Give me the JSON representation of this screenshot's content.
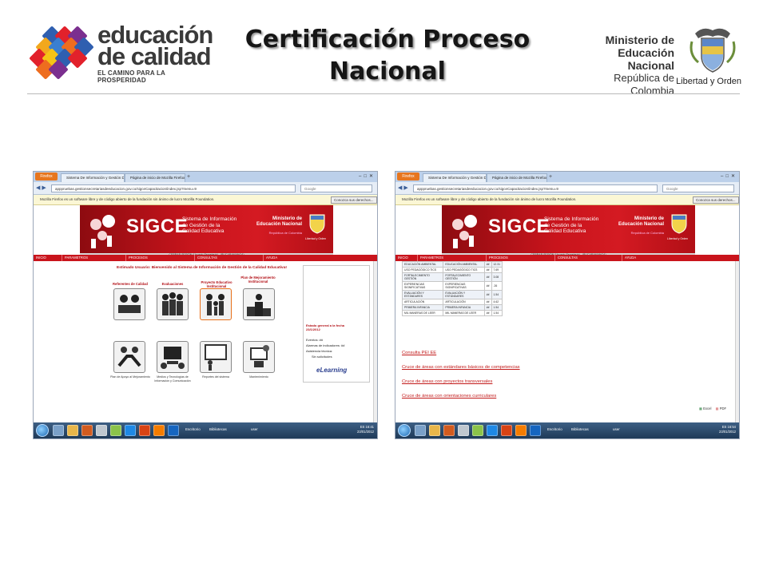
{
  "slide": {
    "title_line1": "Certificación Proceso",
    "title_line2": "Nacional",
    "left_logo": {
      "line1": "educación",
      "line2": "de calidad",
      "tagline": "EL CAMINO PARA LA PROSPERIDAD"
    },
    "right_logo": {
      "line1": "Ministerio de",
      "line2": "Educación Nacional",
      "line3": "República de Colombia",
      "motto": "Libertad y Orden"
    }
  },
  "browser_common": {
    "firefox_button": "Firefox",
    "tab1": "Sistema De Información y Gestión D...",
    "tab2": "Página de inicio de Mozilla Firefox",
    "url": "apppruebas.gestionsecretariasdeeducacion.gov.co/sigceCapacitacion/index.jsp?menu=9",
    "search_placeholder": "Google",
    "infobar_text": "Mozilla Firefox es un software libre y de código abierto de la fundación sin ánimo de lucro Mozilla Foundation.",
    "infobar_button": "Conozca sus derechos...",
    "banner_sigce": "SIGCE",
    "banner_sub1": "Sistema de Información",
    "banner_sub2": "de Gestión de la",
    "banner_sub3": "Calidad Educativa",
    "banner_min1": "Ministerio de",
    "banner_min2": "Educación Nacional",
    "banner_rep": "República de Colombia",
    "banner_motto": "Libertad y Orden",
    "session_text": "CERRAR SESIÓN (Usuario Secretaría) - (BUCARAMANGA)",
    "menu": [
      "INICIO",
      "PARAMETROS",
      "PROCESOS",
      "CONSULTAS",
      "AYUDA"
    ],
    "taskbar_escritorio": "Escritorio",
    "taskbar_bibliotecas": "Bibliotecas",
    "taskbar_user": "user",
    "tray_lang": "ES"
  },
  "left_browser": {
    "welcome": "Estimado Usuario: Bienvenido al Sistema de Información de Gestión de la Calidad Educativa!",
    "modules_top": [
      {
        "label": "Referentes de Calidad"
      },
      {
        "label": "Evaluaciones"
      },
      {
        "label": "Proyecto Educativo Institucional"
      },
      {
        "label": "Plan de Mejoramiento Institucional"
      }
    ],
    "modules_bottom": [
      {
        "label": "Plan de Apoyo al Mejoramiento"
      },
      {
        "label": "Medios y Tecnologías de Información y Comunicación"
      },
      {
        "label": "Reportes del sistema"
      },
      {
        "label": "Mantenimiento"
      }
    ],
    "panel_state_title": "Estado general a la fecha",
    "panel_state_date": "23/1/2012",
    "panel_eventos": "Eventos: ##",
    "panel_alarmas": "Alarmas de indicadores: ##",
    "panel_asistencia": "Asistencia técnica:",
    "panel_solicitudes": "Sin solicitudes",
    "elearning": "eLearning",
    "tray_time": "16:41",
    "tray_date": "23/01/2012"
  },
  "right_browser": {
    "table_rows": [
      [
        "EDUCACIÓN AMBIENTAL",
        "EDUCACIÓN AMBIENTAL",
        "##",
        "12.31"
      ],
      [
        "USO PEDAGÓGICO TICS",
        "USO PEDAGÓGICO TICS",
        "##",
        "7.69"
      ],
      [
        "FORTALECIMIENTO GESTIÓN",
        "FORTALECIMIENTO GESTIÓN",
        "##",
        "3.08"
      ],
      [
        "EXPERIENCIAS SIGNIFICATIVAS",
        "EXPERIENCIAS SIGNIFICATIVAS",
        "##",
        ".26"
      ],
      [
        "EVALUACIÓN Y ESTÁNDARES",
        "EVALUACIÓN Y ESTÁNDARES",
        "##",
        "1.54"
      ],
      [
        "ARTICULACIÓN",
        "ARTICULACIÓN",
        "##",
        "4.62"
      ],
      [
        "PRIMERA INFANCIA",
        "PRIMERA INFANCIA",
        "##",
        "1.54"
      ],
      [
        "MIL MANERAS DE LEER",
        "MIL MANERAS DE LEER",
        "##",
        "1.54"
      ]
    ],
    "links": [
      "Consulta PEI EE",
      "Cruce de áreas con estándares básicos de competencias",
      "Cruce de áreas con proyectos transversales",
      "Cruce de áreas con orientaciones curriculares"
    ],
    "export_excel": "Excel",
    "export_pdf": "PDF",
    "tray_time": "16:54",
    "tray_date": "23/01/2012"
  },
  "colors": {
    "sigce_red": "#c9141c",
    "link_red": "#c21a1a",
    "firefox_orange": "#e7761e",
    "taskbar_blue": "#2c4a6e"
  }
}
